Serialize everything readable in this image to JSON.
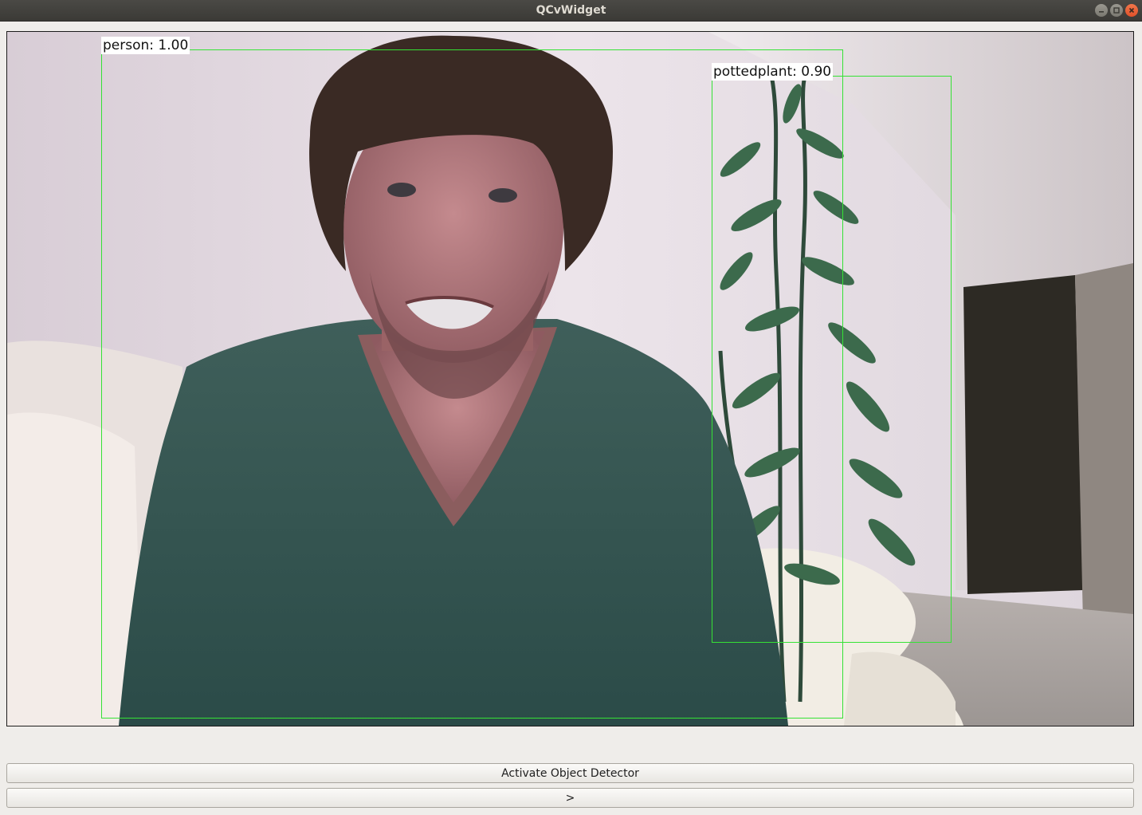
{
  "window": {
    "title": "QCvWidget",
    "controls": [
      "minimize-icon",
      "maximize-icon",
      "close-icon"
    ]
  },
  "detections": [
    {
      "label": "person: 1.00",
      "class": "person",
      "confidence": 1.0
    },
    {
      "label": "pottedplant: 0.90",
      "class": "pottedplant",
      "confidence": 0.9
    }
  ],
  "colors": {
    "box_stroke": "#35e235",
    "label_bg": "#ffffff",
    "close_button": "#e8582f"
  },
  "buttons": {
    "activate_label": "Activate Object Detector",
    "next_label": ">"
  }
}
